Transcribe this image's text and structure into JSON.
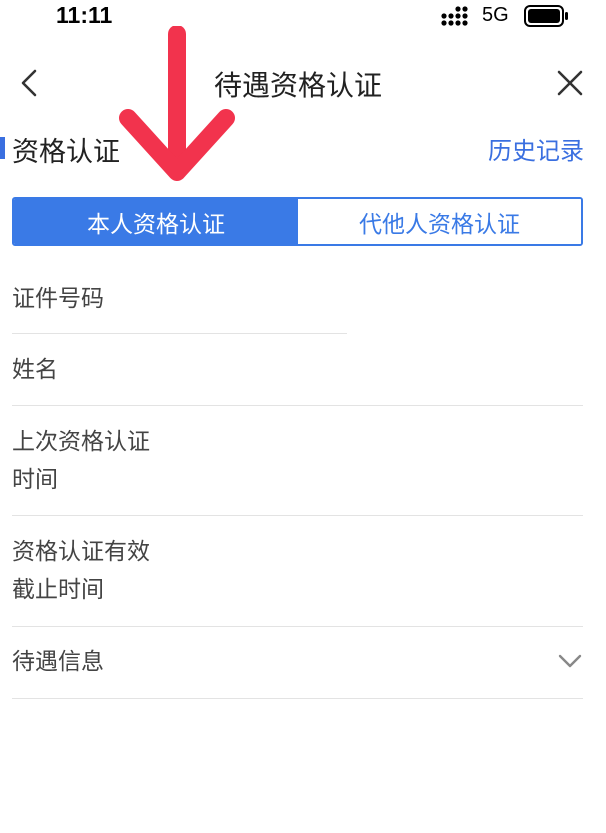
{
  "status_bar": {
    "time": "11:11",
    "network": "5G"
  },
  "nav": {
    "title": "待遇资格认证",
    "back_icon": "chevron-left-icon",
    "close_icon": "close-icon"
  },
  "section": {
    "title": "资格认证",
    "history_link": "历史记录"
  },
  "tabs": [
    {
      "label": "本人资格认证",
      "selected": true
    },
    {
      "label": "代他人资格认证",
      "selected": false
    }
  ],
  "form": {
    "id_number_label": "证件号码",
    "name_label": "姓名",
    "last_cert_label_line1": "上次资格认证",
    "last_cert_label_line2": "时间",
    "cert_valid_label_line1": "资格认证有效",
    "cert_valid_label_line2": "截止时间",
    "benefit_info_label": "待遇信息"
  },
  "colors": {
    "accent": "#3a7ae6",
    "annotation_arrow": "#f2334d"
  }
}
